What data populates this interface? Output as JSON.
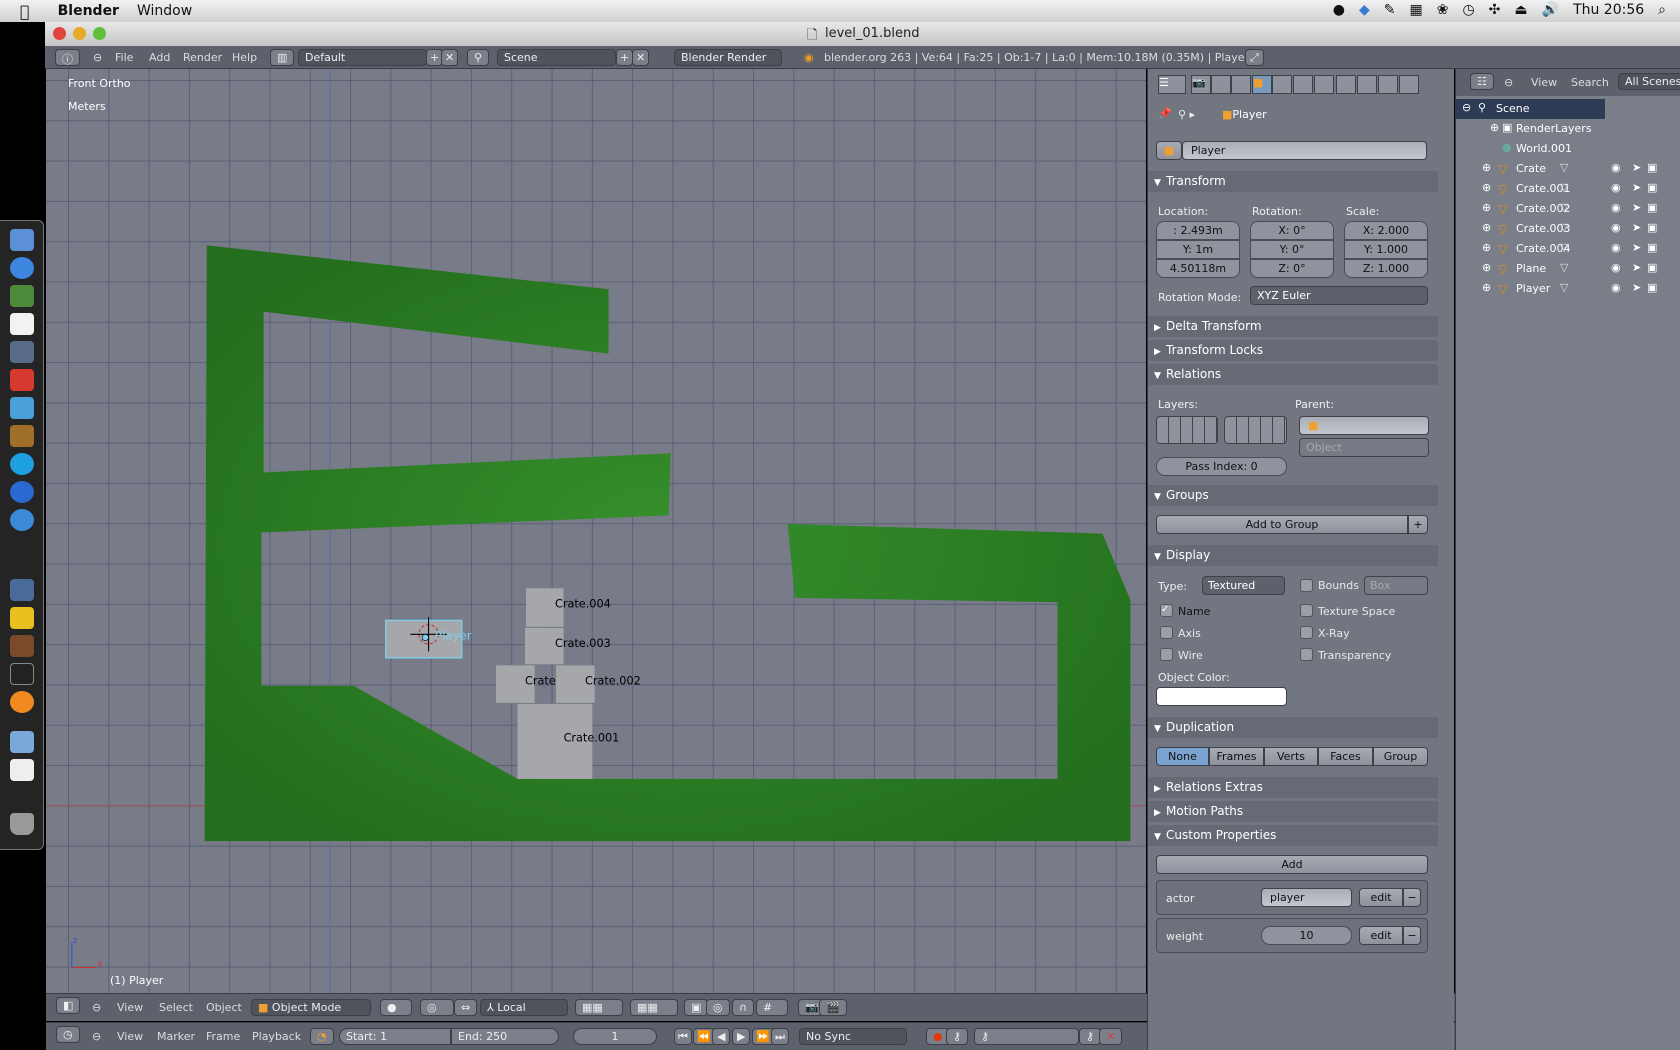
{
  "menubar": {
    "app": "Blender",
    "items": [
      "Window"
    ],
    "clock": "Thu 20:56",
    "status_icons": [
      "check-icon",
      "dropbox-icon",
      "pen-icon",
      "memory-icon",
      "paw-icon",
      "time-machine-icon",
      "bluetooth-icon",
      "eject-icon",
      "volume-icon",
      "spotlight-icon"
    ]
  },
  "window": {
    "title": "level_01.blend"
  },
  "info_header": {
    "menus": [
      "File",
      "Add",
      "Render",
      "Help"
    ],
    "layout": "Default",
    "scene": "Scene",
    "engine": "Blender Render",
    "stats": "blender.org 263 | Ve:64 | Fa:25 | Ob:1-7 | La:0 | Mem:10.18M (0.35M) | Player"
  },
  "viewport": {
    "view_name": "Front Ortho",
    "units": "Meters",
    "selected_label": "(1) Player",
    "axis_z": "z",
    "axis_x": "x",
    "objects": {
      "player": "Player",
      "crate": "Crate",
      "crate001": "Crate.001",
      "crate002": "Crate.002",
      "crate003": "Crate.003",
      "crate004": "Crate.004"
    },
    "ground_color": "#2a7a22",
    "crate_color": "#a6a7ab",
    "selection_color": "#7ecfee"
  },
  "view3d_header": {
    "menus": [
      "View",
      "Select",
      "Object"
    ],
    "mode": "Object Mode",
    "orientation": "Local"
  },
  "timeline": {
    "menus": [
      "View",
      "Marker",
      "Frame",
      "Playback"
    ],
    "start": "Start: 1",
    "end": "End: 250",
    "current": "1",
    "sync": "No Sync"
  },
  "properties": {
    "breadcrumb": "Player",
    "object_name": "Player",
    "transform": {
      "title": "Transform",
      "location_label": "Location:",
      "rotation_label": "Rotation:",
      "scale_label": "Scale:",
      "location": [
        ": 2.493m",
        "Y: 1m",
        "4.50118m"
      ],
      "rotation": [
        "X: 0°",
        "Y: 0°",
        "Z: 0°"
      ],
      "scale": [
        "X: 2.000",
        "Y: 1.000",
        "Z: 1.000"
      ],
      "rotation_mode_label": "Rotation Mode:",
      "rotation_mode": "XYZ Euler"
    },
    "delta_transform": "Delta Transform",
    "transform_locks": "Transform Locks",
    "relations": {
      "title": "Relations",
      "layers_label": "Layers:",
      "parent_label": "Parent:",
      "parent_type": "Object",
      "pass_index": "Pass Index: 0"
    },
    "groups": {
      "title": "Groups",
      "add_label": "Add to Group"
    },
    "display": {
      "title": "Display",
      "type_label": "Type:",
      "type": "Textured",
      "bounds": "Bounds",
      "bounds_type": "Box",
      "name": "Name",
      "axis": "Axis",
      "wire": "Wire",
      "texture_space": "Texture Space",
      "xray": "X-Ray",
      "transparency": "Transparency",
      "object_color_label": "Object Color:",
      "object_color": "#ffffff",
      "name_checked": true
    },
    "duplication": {
      "title": "Duplication",
      "options": [
        "None",
        "Frames",
        "Verts",
        "Faces",
        "Group"
      ],
      "selected": "None"
    },
    "relations_extras": "Relations Extras",
    "motion_paths": "Motion Paths",
    "custom_properties": {
      "title": "Custom Properties",
      "add_label": "Add",
      "items": [
        {
          "key": "actor",
          "value": "player",
          "edit": "edit"
        },
        {
          "key": "weight",
          "value": "10",
          "edit": "edit"
        }
      ]
    }
  },
  "outliner": {
    "view": "View",
    "search": "Search",
    "filter": "All Scenes",
    "tree": [
      "Scene",
      "RenderLayers",
      "World.001",
      "Crate",
      "Crate.001",
      "Crate.002",
      "Crate.003",
      "Crate.004",
      "Plane",
      "Player"
    ]
  }
}
